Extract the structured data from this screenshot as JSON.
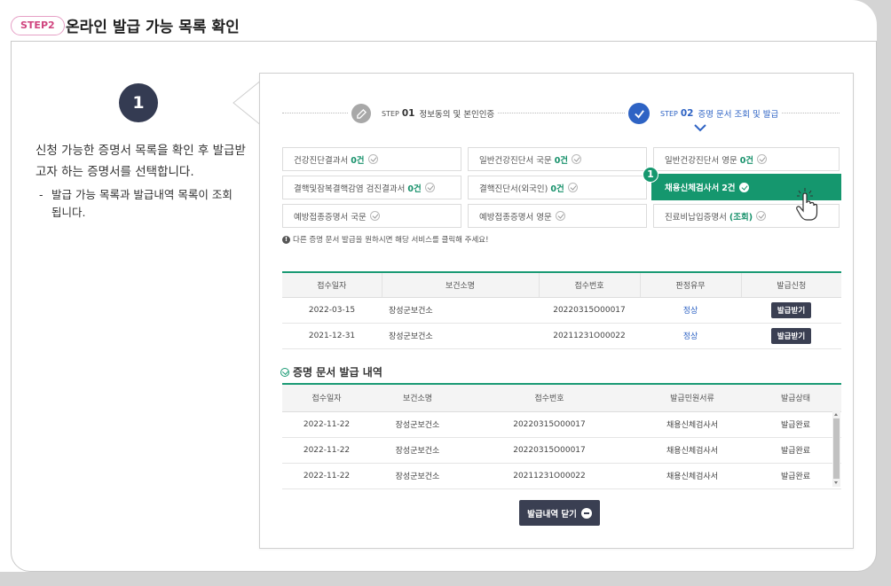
{
  "header": {
    "step_badge": "STEP2",
    "title": "온라인 발급 가능 목록 확인"
  },
  "guide": {
    "number": "1",
    "description": "신청 가능한 증명서 목록을 확인 후 발급받고자 하는 증명서를 선택합니다.",
    "note_dash": "-",
    "note": "발급 가능 목록과 발급내역 목록이 조회됩니다."
  },
  "steps": [
    {
      "small": "STEP",
      "num": "01",
      "label": "정보동의 및 본인인증",
      "icon": "edit-icon"
    },
    {
      "small": "STEP",
      "num": "02",
      "label": "증명 문서 조회 및 발급",
      "icon": "check-icon"
    }
  ],
  "documents": [
    {
      "name": "건강진단결과서",
      "count": "0건"
    },
    {
      "name": "일반건강진단서 국문",
      "count": "0건"
    },
    {
      "name": "일반건강진단서 영문",
      "count": "0건"
    },
    {
      "name": "결핵및잠복결핵감염 검진결과서",
      "count": "0건"
    },
    {
      "name": "결핵진단서(외국인)",
      "count": "0건"
    },
    {
      "name": "채용신체검사서",
      "count": "2건"
    },
    {
      "name": "예방접종증명서 국문",
      "count": ""
    },
    {
      "name": "예방접종증명서 영문",
      "count": ""
    },
    {
      "name": "진료비납입증명서",
      "count": "(조회)"
    }
  ],
  "callout_number": "1",
  "notice": "다른 증명 문서 발급을 원하시면 해당 서비스를 클릭해 주세요!",
  "available_table": {
    "headers": [
      "접수일자",
      "보건소명",
      "접수번호",
      "판정유무",
      "발급신청"
    ],
    "rows": [
      {
        "date": "2022-03-15",
        "center": "장성군보건소",
        "receipt": "20220315O00017",
        "result": "정상",
        "action": "발급받기"
      },
      {
        "date": "2021-12-31",
        "center": "장성군보건소",
        "receipt": "20211231O00022",
        "result": "정상",
        "action": "발급받기"
      }
    ]
  },
  "history": {
    "title": "증명 문서 발급 내역",
    "headers": [
      "접수일자",
      "보건소명",
      "접수번호",
      "발급민원서류",
      "발급상태"
    ],
    "rows": [
      {
        "date": "2022-11-22",
        "center": "장성군보건소",
        "receipt": "20220315O00017",
        "doc": "채용신체검사서",
        "status": "발급완료"
      },
      {
        "date": "2022-11-22",
        "center": "장성군보건소",
        "receipt": "20220315O00017",
        "doc": "채용신체검사서",
        "status": "발급완료"
      },
      {
        "date": "2022-11-22",
        "center": "장성군보건소",
        "receipt": "20211231O00022",
        "doc": "채용신체검사서",
        "status": "발급완료"
      }
    ]
  },
  "close_button": "발급내역 닫기",
  "colors": {
    "accent": "#15976e",
    "primary_blue": "#2e63c4",
    "dark_button": "#3a3f52",
    "badge_pink": "#d0457f"
  }
}
